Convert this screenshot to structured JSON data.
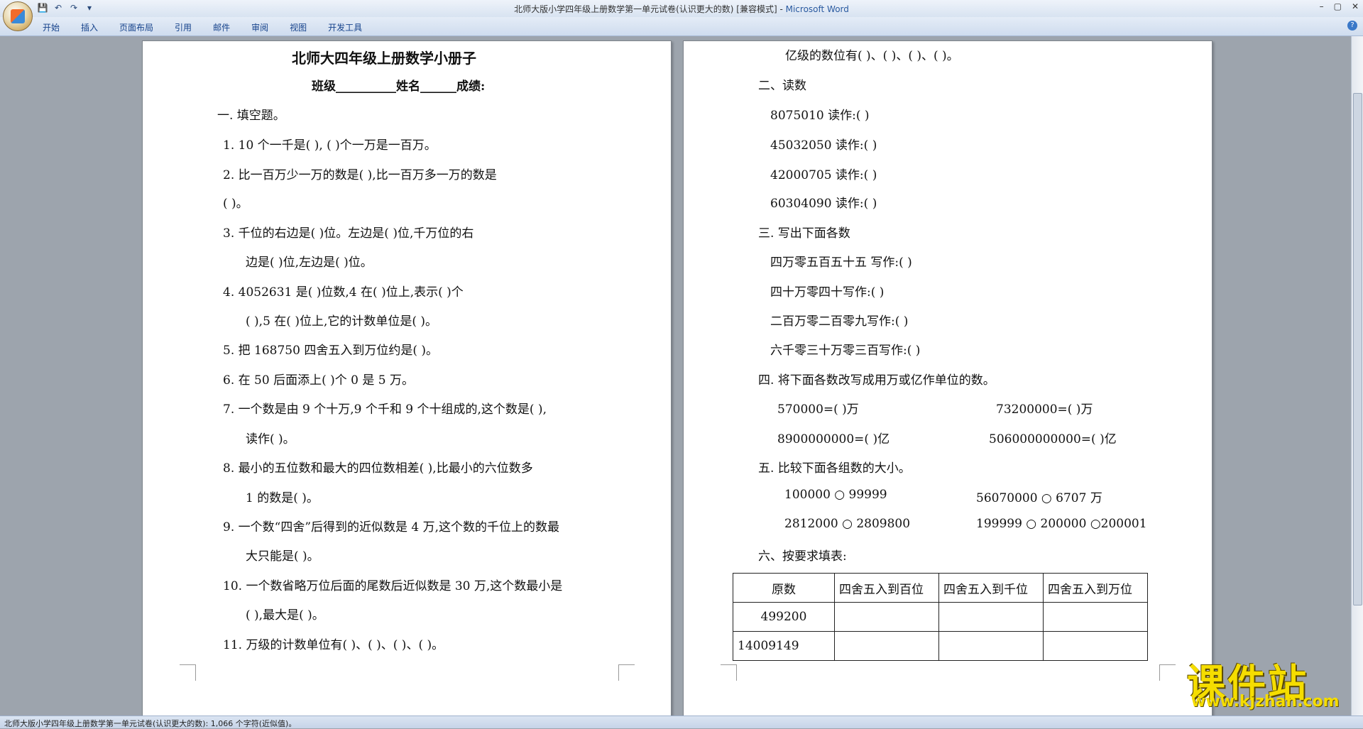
{
  "window": {
    "title_doc": "北师大版小学四年级上册数学第一单元试卷(认识更大的数) [兼容模式] - ",
    "title_app": "Microsoft Word",
    "controls": [
      "–",
      "▢",
      "✕"
    ]
  },
  "ribbon": {
    "tabs": [
      "开始",
      "插入",
      "页面布局",
      "引用",
      "邮件",
      "审阅",
      "视图",
      "开发工具"
    ],
    "help": "?"
  },
  "left_page": {
    "heading": "北师大四年级上册数学小册子",
    "info_line": "班级__________姓名______成绩:",
    "lines": [
      "一.    填空题。",
      "1. 10 个一千是(          ),          (      )个一万是一百万。",
      "2. 比一百万少一万的数是(          ),比一百万多一万的数是",
      "(          )。",
      "3. 千位的右边是(        )位。左边是(          )位,千万位的右",
      "边是(        )位,左边是(          )位。",
      "4. 4052631 是(        )位数,4 在(          )位上,表示(      )个",
      "(        ),5 在(        )位上,它的计数单位是(          )。",
      "5. 把 168750 四舍五入到万位约是(                    )。",
      "6. 在 50 后面添上(            )个 0 是 5 万。",
      "7. 一个数是由 9 个十万,9 个千和 9 个十组成的,这个数是(        ),",
      "读作(                  )。",
      "8. 最小的五位数和最大的四位数相差(          ),比最小的六位数多",
      "1 的数是(            )。",
      "9. 一个数“四舍”后得到的近似数是 4 万,这个数的千位上的数最",
      "大只能是(              )。",
      "10. 一个数省略万位后面的尾数后近似数是 30 万,这个数最小是",
      "(                  ),最大是(                        )。",
      "11. 万级的计数单位有(          )、(          )、(          )、(          )。"
    ]
  },
  "right_page": {
    "lines": [
      "亿级的数位有(          )、(          )、(          )、(          )。",
      "二、读数",
      "8075010 读作:(                                    )",
      "45032050 读作:(                                  )",
      "42000705 读作:(                                  )",
      "60304090 读作:(                                  )",
      "三. 写出下面各数",
      "四万零五百五十五 写作:(                          )",
      "四十万零四十写作:(                                    )",
      "二百万零二百零九写作:(                              )",
      "六千零三十万零三百写作:(                          )",
      "四. 将下面各数改写成用万或亿作单位的数。",
      "570000=(          )万",
      "73200000=(            )万",
      "8900000000=(          )亿",
      "506000000000=(          )亿",
      "五. 比较下面各组数的大小。",
      "100000  ○  99999",
      "56070000  ○      6707 万",
      "2812000      ○ 2809800",
      "199999 ○ 200000   ○200001",
      "六、按要求填表:"
    ],
    "table": {
      "headers": [
        "原数",
        "四舍五入到百位",
        "四舍五入到千位",
        "四舍五入到万位"
      ],
      "rows": [
        [
          "499200",
          "",
          "",
          ""
        ],
        [
          "14009149",
          "",
          "",
          ""
        ]
      ]
    }
  },
  "statusbar": {
    "text": "北师大版小学四年级上册数学第一单元试卷(认识更大的数): 1,066 个字符(近似值)。"
  },
  "watermark": {
    "text": "课件站",
    "url": "www.kjzhan.com"
  }
}
